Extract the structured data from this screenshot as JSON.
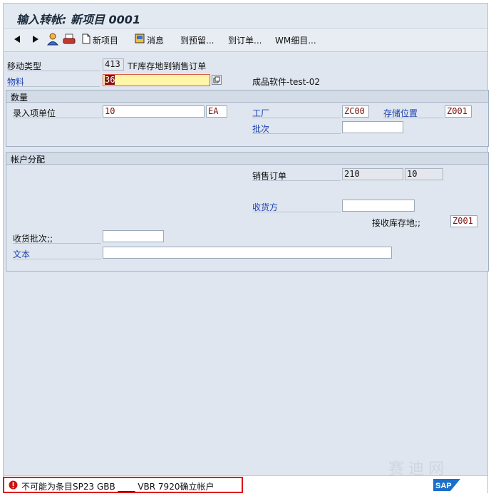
{
  "window": {
    "title": "输入转帐: 新项目 0001"
  },
  "toolbar": {
    "new_item": "新项目",
    "messages": "消息",
    "to_reservation": "到预留...",
    "to_order": "到订单...",
    "wm_detail": "WM细目..."
  },
  "header": {
    "movement_type_label": "移动类型",
    "movement_type_value": "413",
    "movement_type_text": "TF库存地到销售订单",
    "material_label": "物料",
    "material_value": "36",
    "material_desc": "成品软件-test-02"
  },
  "quantity": {
    "group_title": "数量",
    "qty_label": "录入项单位",
    "qty_value": "10",
    "unit_value": "EA",
    "plant_label": "工厂",
    "plant_value": "ZC00",
    "sloc_label": "存储位置",
    "sloc_value": "Z001",
    "batch_label": "批次",
    "batch_value": ""
  },
  "account": {
    "group_title": "帐户分配",
    "sales_order_label": "销售订单",
    "sales_order_value": "210",
    "sales_order_item": "10",
    "recipient_label": "收货方",
    "recipient_value": "",
    "recv_sloc_label": "接收库存地;;",
    "recv_sloc_value": "Z001",
    "recv_batch_label": "收货批次;;",
    "recv_batch_value": "",
    "text_label": "文本",
    "text_value": ""
  },
  "status": {
    "message": "不可能为条目SP23 GBB ____ VBR 7920确立帐户"
  },
  "watermark": "赛迪网",
  "colors": {
    "accent_red": "#e00000",
    "field_yellow": "#fff7a8",
    "link_blue": "#1b3fb0"
  }
}
